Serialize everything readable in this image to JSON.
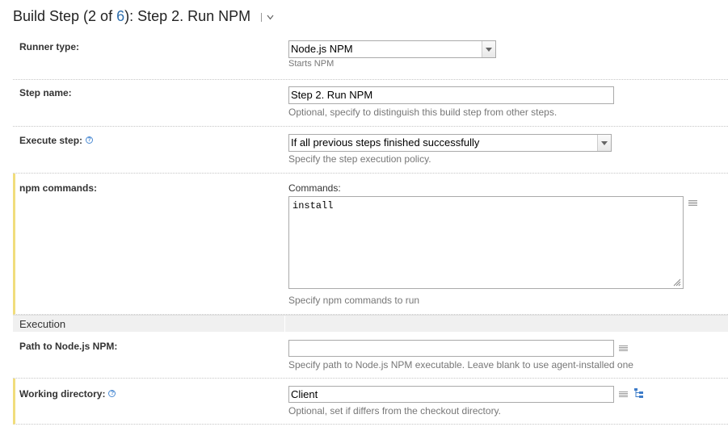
{
  "header": {
    "prefix": "Build Step (2 of ",
    "total": "6",
    "suffix": "): Step 2. Run NPM"
  },
  "runner_type": {
    "label": "Runner type:",
    "value": "Node.js NPM",
    "hint": "Starts NPM"
  },
  "step_name": {
    "label": "Step name:",
    "value": "Step 2. Run NPM",
    "hint": "Optional, specify to distinguish this build step from other steps."
  },
  "execute_step": {
    "label": "Execute step:",
    "value": "If all previous steps finished successfully",
    "hint": "Specify the step execution policy."
  },
  "npm_commands": {
    "label": "npm commands:",
    "sublabel": "Commands:",
    "value": "install",
    "hint": "Specify npm commands to run"
  },
  "execution_section": {
    "title": "Execution"
  },
  "npm_path": {
    "label": "Path to Node.js NPM:",
    "value": "",
    "hint": "Specify path to Node.js NPM executable. Leave blank to use agent-installed one"
  },
  "working_directory": {
    "label": "Working directory:",
    "value": "Client",
    "hint": "Optional, set if differs from the checkout directory."
  },
  "icons": {
    "help": "question-mark",
    "dropdown": "triangle-down",
    "text_editor": "lines",
    "tree_picker": "tree"
  },
  "colors": {
    "highlight_border": "#f1dd7c",
    "link": "#2f6fad",
    "help_icon": "#4a8ad3"
  }
}
